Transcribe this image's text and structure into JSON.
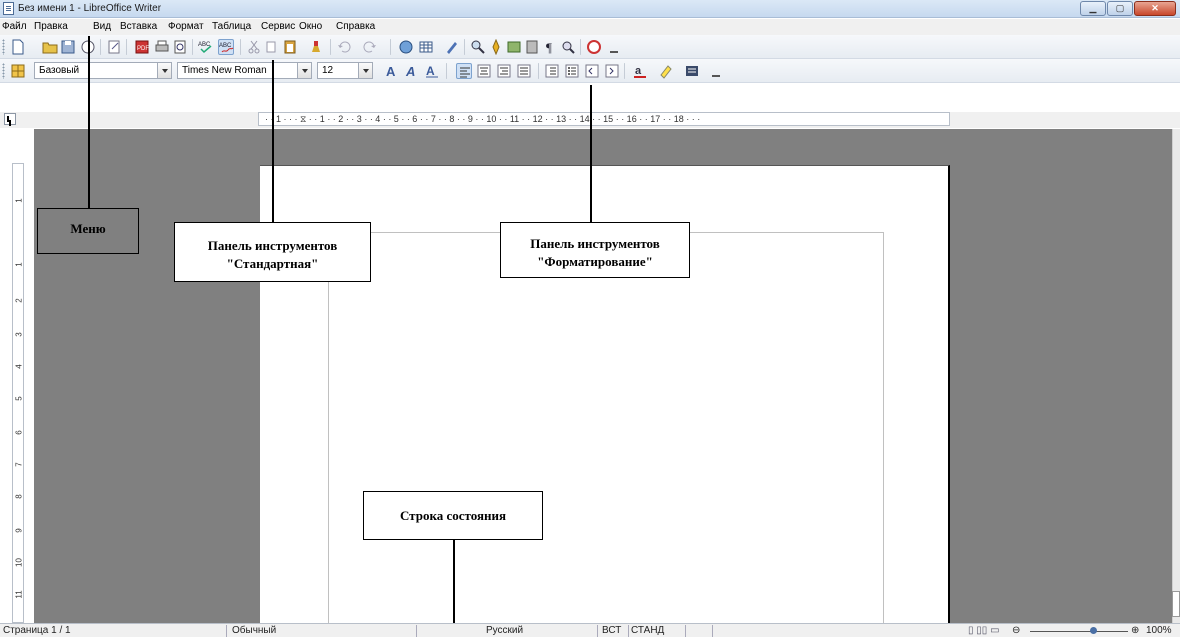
{
  "window": {
    "title": "Без имени 1 - LibreOffice Writer"
  },
  "menu": [
    "Файл",
    "Правка",
    "Вид",
    "Вставка",
    "Формат",
    "Таблица",
    "Сервис",
    "Окно",
    "Справка"
  ],
  "format_toolbar": {
    "style_value": "Базовый",
    "font_value": "Times New Roman",
    "size_value": "12"
  },
  "ruler": {
    "marks": "· · 1 · · · ⧖ · · 1 · · 2 · · 3 · · 4 · · 5 · · 6 · · 7 · · 8 · · 9 · · 10 · · 11 · · 12 · · 13 · · 14 · · 15 · · 16 · · 17 · · 18 · · ·",
    "vertical_numbers": [
      "1",
      "1",
      "2",
      "3",
      "4",
      "5",
      "6",
      "7",
      "8",
      "9",
      "10",
      "11"
    ]
  },
  "annotations": {
    "menu": "Меню",
    "standard_line1": "Панель инструментов",
    "standard_line2": "\"Стандартная\"",
    "format_line1": "Панель инструментов",
    "format_line2": "\"Форматирование\"",
    "status": "Строка состояния"
  },
  "status": {
    "page": "Страница 1 / 1",
    "style": "Обычный",
    "language": "Русский",
    "insert": "ВСТ",
    "selection": "СТАНД",
    "zoom": "100%"
  },
  "colors": {
    "workspace": "#808080",
    "page": "#ffffff",
    "toolbar": "#eef2f7"
  }
}
